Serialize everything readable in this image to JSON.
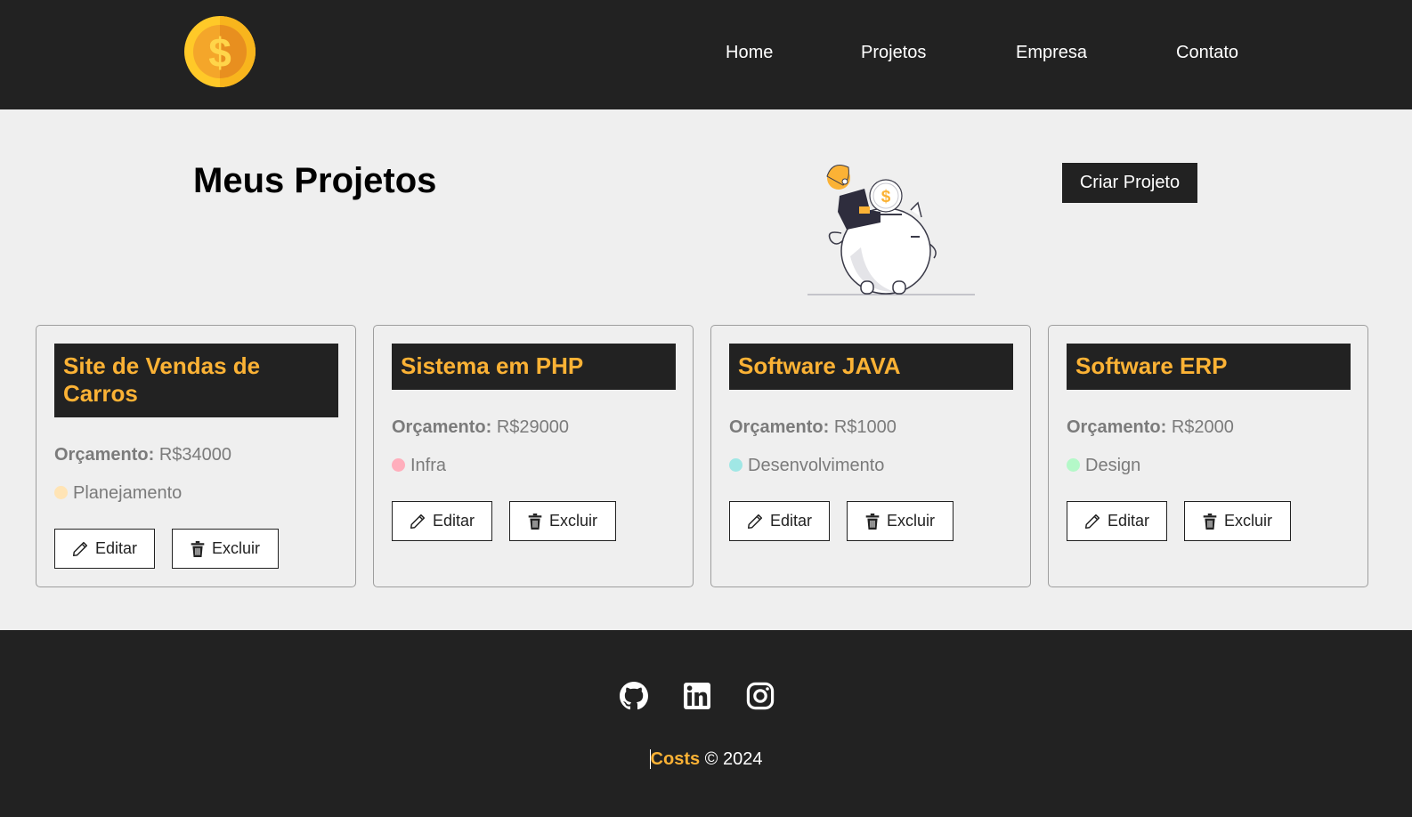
{
  "nav": {
    "links": [
      "Home",
      "Projetos",
      "Empresa",
      "Contato"
    ]
  },
  "main": {
    "title": "Meus Projetos",
    "create_button": "Criar Projeto"
  },
  "projects": [
    {
      "name": "Site de Vendas de Carros",
      "budget_label": "Orçamento:",
      "budget": "R$34000",
      "category": "Planejamento",
      "category_color": "#ffe4b5",
      "edit_label": "Editar",
      "delete_label": "Excluir"
    },
    {
      "name": "Sistema em PHP",
      "budget_label": "Orçamento:",
      "budget": "R$29000",
      "category": "Infra",
      "category_color": "#ffaebc",
      "edit_label": "Editar",
      "delete_label": "Excluir"
    },
    {
      "name": "Software JAVA",
      "budget_label": "Orçamento:",
      "budget": "R$1000",
      "category": "Desenvolvimento",
      "category_color": "#a0e7e5",
      "edit_label": "Editar",
      "delete_label": "Excluir"
    },
    {
      "name": "Software ERP",
      "budget_label": "Orçamento:",
      "budget": "R$2000",
      "category": "Design",
      "category_color": "#b4f8c8",
      "edit_label": "Editar",
      "delete_label": "Excluir"
    }
  ],
  "footer": {
    "social_icons": [
      "github-icon",
      "linkedin-icon",
      "instagram-icon"
    ],
    "brand": "Costs",
    "copyright": " © 2024"
  },
  "colors": {
    "dark": "#222222",
    "accent": "#fbb235",
    "background": "#efefef"
  }
}
